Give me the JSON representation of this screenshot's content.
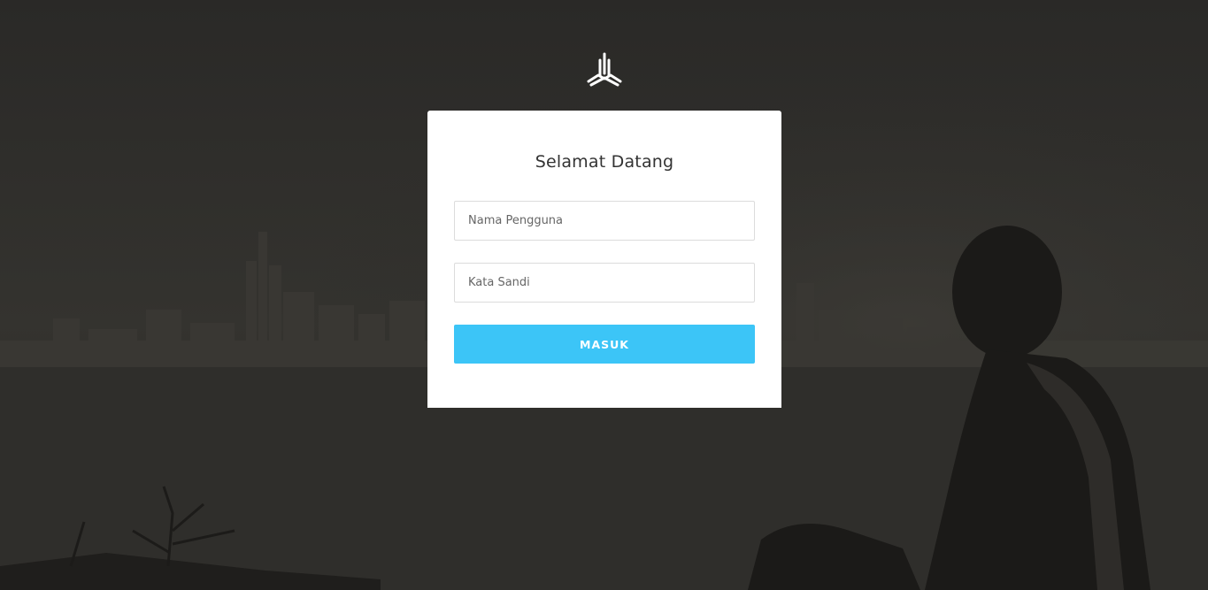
{
  "login": {
    "title": "Selamat Datang",
    "username_placeholder": "Nama Pengguna",
    "password_placeholder": "Kata Sandi",
    "username_value": "",
    "password_value": "",
    "submit_label": "MASUK"
  },
  "logo": {
    "icon": "tripod-logo-icon",
    "color": "#ffffff"
  },
  "colors": {
    "card": "#ffffff",
    "button": "#3cc5f7",
    "background": "#2b2a28"
  }
}
